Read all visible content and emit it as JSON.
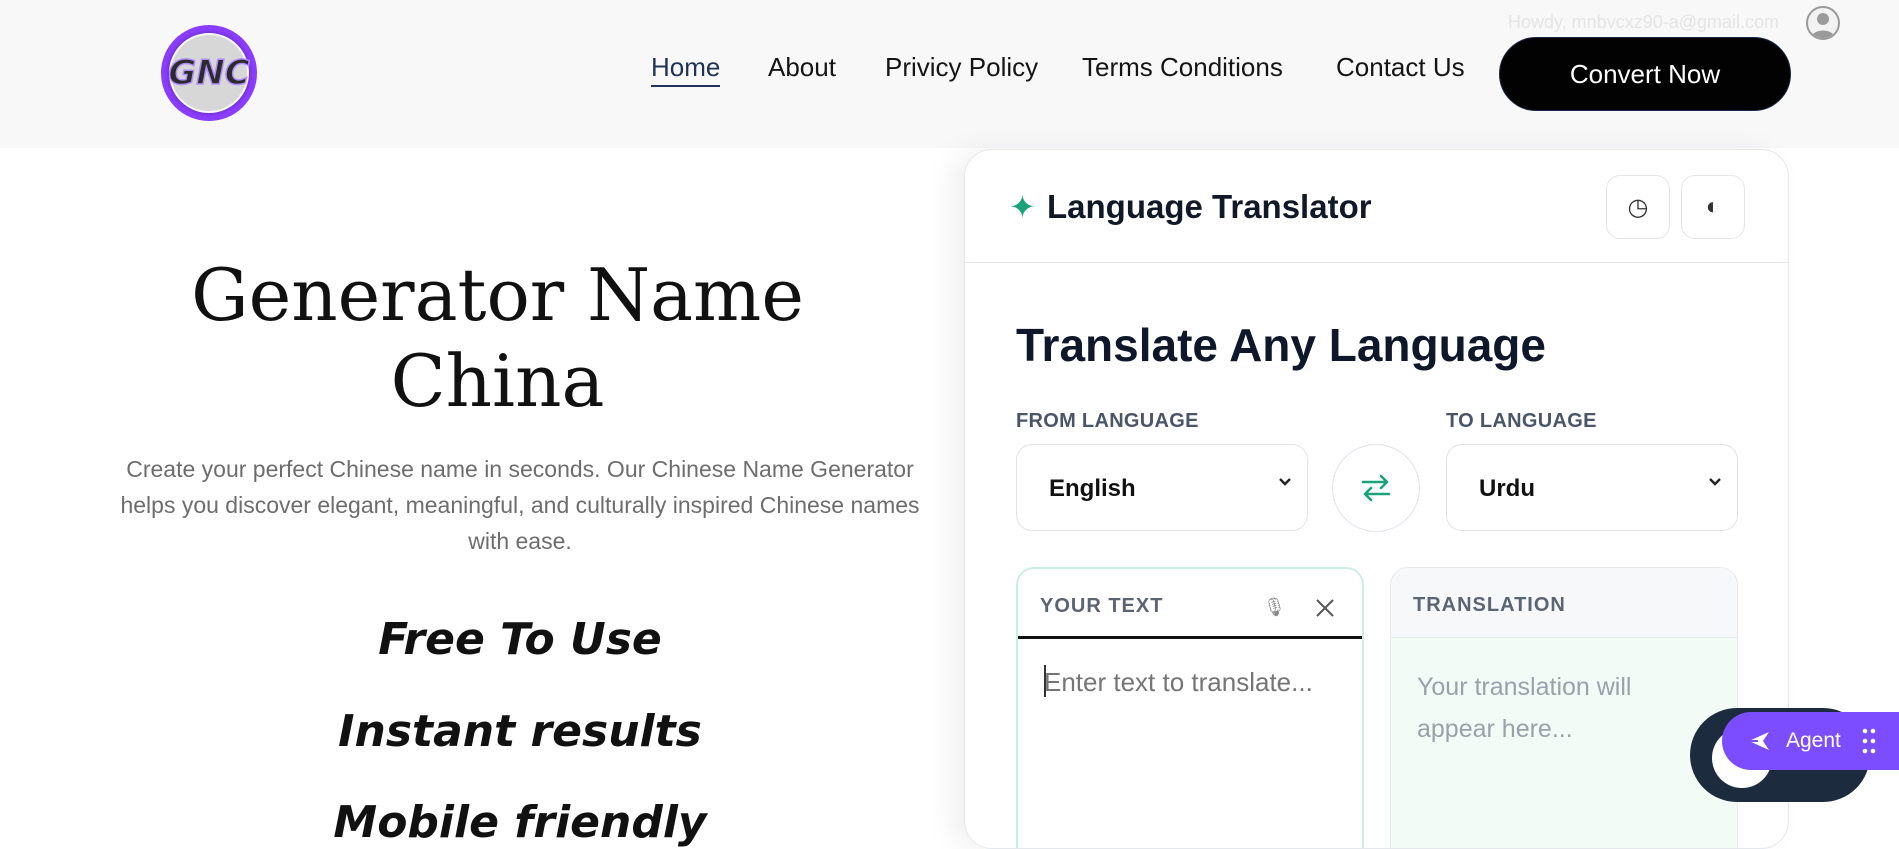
{
  "header": {
    "logo_text": "GNC",
    "howdy": "Howdy, mnbvcxz90-a@gmail.com",
    "nav": [
      {
        "label": "Home",
        "active": true
      },
      {
        "label": "About"
      },
      {
        "label": "Privicy Policy"
      },
      {
        "label": "Terms Conditions"
      },
      {
        "label": "Contact Us"
      }
    ],
    "convert_label": "Convert Now"
  },
  "hero": {
    "title_line1": "Generator Name",
    "title_line2": "China",
    "description": "Create your perfect Chinese name in seconds. Our Chinese Name Generator helps you discover elegant, meaningful, and culturally inspired Chinese names with ease.",
    "features": [
      "Free To Use",
      "Instant results",
      "Mobile friendly"
    ]
  },
  "translator": {
    "title": "Language Translator",
    "history_icon": "◷",
    "theme_icon": "◐",
    "heading": "Translate Any Language",
    "from_label": "FROM LANGUAGE",
    "from_value": "English",
    "to_label": "TO LANGUAGE",
    "to_value": "Urdu",
    "input_label": "YOUR TEXT",
    "input_placeholder": "Enter text to translate...",
    "output_label": "TRANSLATION",
    "output_placeholder": "Your translation will appear here..."
  },
  "widgets": {
    "agent_label": "Agent"
  },
  "colors": {
    "accent_green": "#1aa37a",
    "agent_purple": "#7c4dff",
    "nav_active": "#1f3358"
  }
}
